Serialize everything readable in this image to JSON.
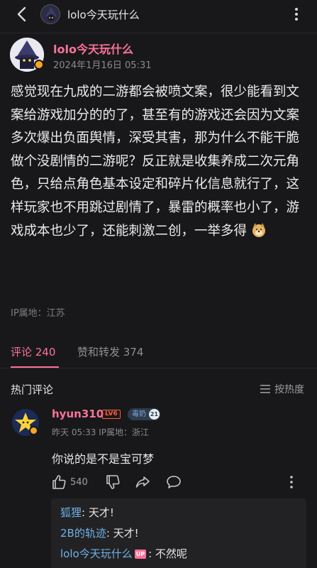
{
  "topbar": {
    "title": "lolo今天玩什么"
  },
  "post": {
    "author": "lolo今天玩什么",
    "time": "2024年1月16日 05:31",
    "body": "感觉现在九成的二游都会被喷文案，很少能看到文案给游戏加分的的了，甚至有的游戏还会因为文案多次爆出负面舆情，深受其害，那为什么不能干脆做个没剧情的二游呢？反正就是收集养成二次元角色，只给点角色基本设定和碎片化信息就行了，这样玩家也不用跳过剧情了，暴雷的概率也小了，游戏成本也少了，还能刺激二创，一举多得",
    "ip": "IP属地：江苏"
  },
  "tabs": {
    "comments": "评论 240",
    "likes": "赞和转发 374"
  },
  "comments_section": {
    "title": "热门评论",
    "sort": "按热度"
  },
  "comment": {
    "name": "hyun310",
    "level": "LV6",
    "medal": "毒奶",
    "medal_level": "21",
    "meta": "昨天 05:33  IP属地：浙江",
    "text": "你说的是不是宝可梦",
    "likes": "540",
    "replies": [
      {
        "name": "狐狸",
        "text": ": 天才!"
      },
      {
        "name": "2B的轨迹",
        "text": ": 天才!"
      },
      {
        "name": "lolo今天玩什么",
        "tag": "UP",
        "text": ": 不然呢"
      }
    ]
  },
  "colors": {
    "accent": "#fb7299",
    "reply_name": "#6fb1e8",
    "background": "#18181a"
  }
}
